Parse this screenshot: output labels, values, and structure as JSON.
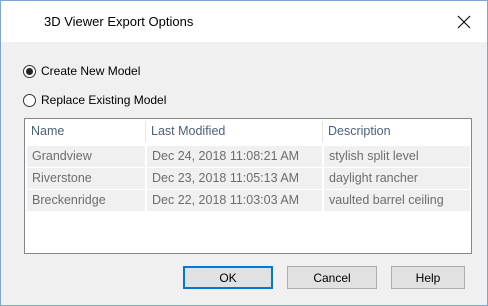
{
  "dialog": {
    "title": "3D Viewer Export Options",
    "close_icon": "close-icon"
  },
  "options": {
    "create_new": {
      "label": "Create New Model",
      "selected": true
    },
    "replace_existing": {
      "label": "Replace Existing Model",
      "selected": false
    }
  },
  "models_list": {
    "columns": [
      "Name",
      "Last Modified",
      "Description"
    ],
    "rows": [
      {
        "name": "Grandview",
        "modified": "Dec 24, 2018 11:08:21 AM",
        "description": "stylish split level"
      },
      {
        "name": "Riverstone",
        "modified": "Dec 23, 2018 11:05:13 AM",
        "description": "daylight rancher"
      },
      {
        "name": "Breckenridge",
        "modified": "Dec 22, 2018 11:03:03 AM",
        "description": "vaulted barrel ceiling"
      }
    ]
  },
  "buttons": {
    "ok": "OK",
    "cancel": "Cancel",
    "help": "Help"
  },
  "colors": {
    "accent": "#0078d7",
    "window_border": "#7aa7d6",
    "disabled_text": "#6d6d6d"
  }
}
